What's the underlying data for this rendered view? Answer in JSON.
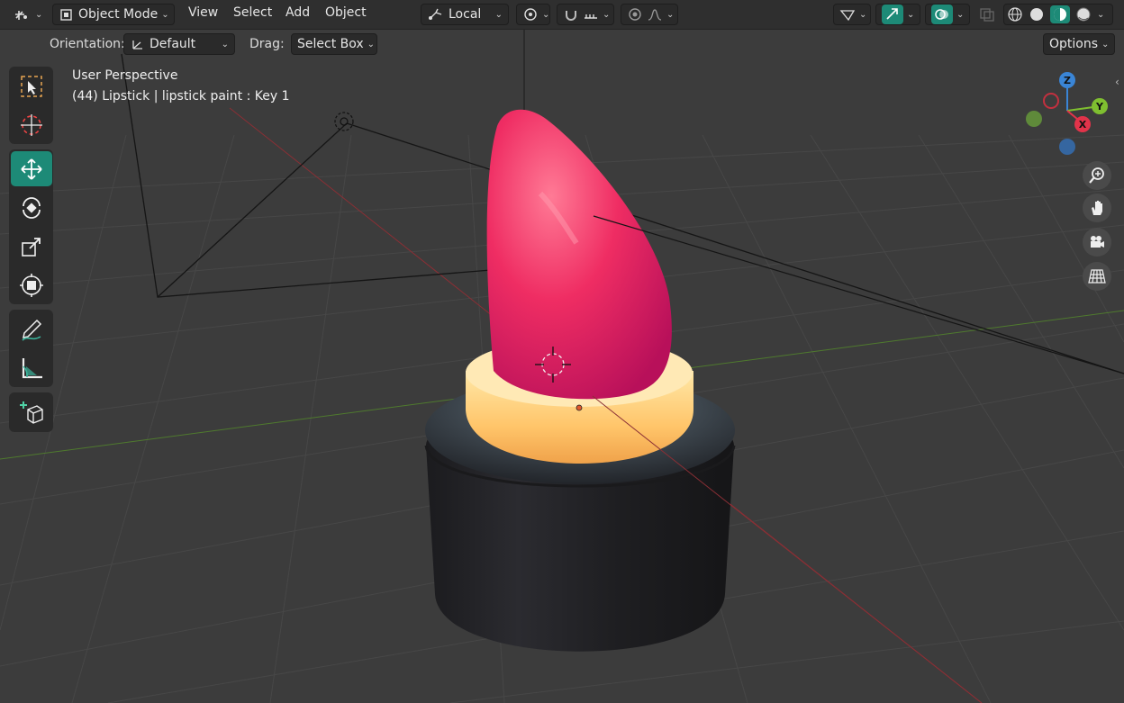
{
  "header": {
    "mode_label": "Object Mode",
    "menus": [
      "View",
      "Select",
      "Add",
      "Object"
    ],
    "transform_pivot": "Local",
    "options_label": "Options"
  },
  "tool_settings": {
    "orientation_label": "Orientation:",
    "orientation_value": "Default",
    "drag_label": "Drag:",
    "drag_value": "Select Box"
  },
  "viewport": {
    "perspective_text": "User Perspective",
    "object_info": "(44) Lipstick | lipstick paint : Key 1",
    "background": "#3c3c3c"
  },
  "gizmo": {
    "z_label": "Z",
    "y_label": "Y",
    "x_label": "X",
    "colors": {
      "x": "#e2334a",
      "y": "#7fbf30",
      "z": "#3a85d6"
    }
  },
  "toolbar": {
    "active_tool": "move",
    "tools": [
      "select-box",
      "cursor",
      "move",
      "rotate",
      "scale",
      "transform",
      "annotate",
      "measure",
      "add-cube"
    ]
  },
  "accent": "#1d8a77"
}
